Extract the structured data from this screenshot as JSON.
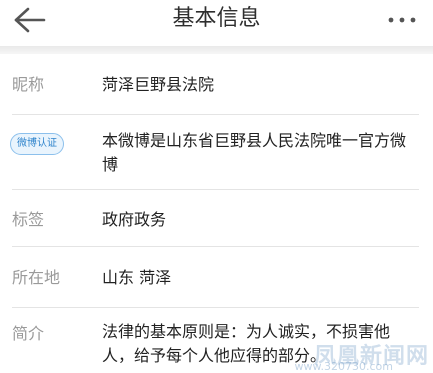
{
  "header": {
    "title": "基本信息",
    "back_icon": "back-arrow-icon",
    "more_icon": "more-dots-icon"
  },
  "rows": {
    "nickname": {
      "label": "昵称",
      "value": "菏泽巨野县法院"
    },
    "verification": {
      "badge": "微博认证",
      "value": "本微博是山东省巨野县人民法院唯一官方微博"
    },
    "tags": {
      "label": "标签",
      "value": "政府政务"
    },
    "location": {
      "label": "所在地",
      "value": "山东 菏泽"
    },
    "intro": {
      "label": "简介",
      "value": "法律的基本原则是：为人诚实，不损害他人，给予每个人他应得的部分。"
    }
  },
  "watermark": {
    "text": "凤凰新闻网",
    "url": "www.320730.com"
  },
  "colors": {
    "badge_border": "#8cc0ec",
    "badge_text": "#2f84cc",
    "label_text": "#9a9a9a",
    "value_text": "#222222"
  }
}
